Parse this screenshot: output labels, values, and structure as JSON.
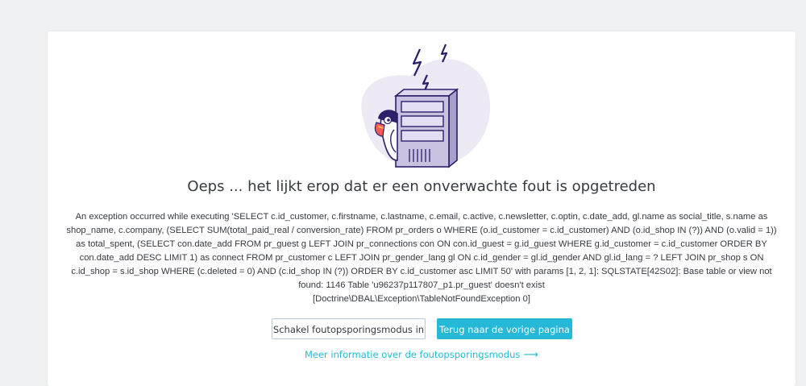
{
  "error": {
    "title": "Oeps ... het lijkt erop dat er een onverwachte fout is opgetreden",
    "message": "An exception occurred while executing 'SELECT c.id_customer, c.firstname, c.lastname, c.email, c.active, c.newsletter, c.optin, c.date_add, gl.name as social_title, s.name as shop_name, c.company, (SELECT SUM(total_paid_real / conversion_rate) FROM pr_orders o WHERE (o.id_customer = c.id_customer) AND (o.id_shop IN (?)) AND (o.valid = 1)) as total_spent, (SELECT con.date_add FROM pr_guest g LEFT JOIN pr_connections con ON con.id_guest = g.id_guest WHERE g.id_customer = c.id_customer ORDER BY con.date_add DESC LIMIT 1) as connect FROM pr_customer c LEFT JOIN pr_gender_lang gl ON c.id_gender = gl.id_gender AND gl.id_lang = ? LEFT JOIN pr_shop s ON c.id_shop = s.id_shop WHERE (c.deleted = 0) AND (c.id_shop IN (?)) ORDER BY c.id_customer asc LIMIT 50' with params [1, 2, 1]: SQLSTATE[42S02]: Base table or view not found: 1146 Table 'u96237p117807_p1.pr_guest' doesn't exist",
    "exception_class": "[Doctrine\\DBAL\\Exception\\TableNotFoundException 0]"
  },
  "actions": {
    "debug_button": "Schakel foutopsporingsmodus in",
    "back_button": "Terug naar de vorige pagina",
    "more_info_link": "Meer informatie over de foutopsporingsmodus",
    "more_info_arrow": "⟶"
  },
  "colors": {
    "accent": "#25b9d7",
    "text": "#363a41",
    "background": "#eff1f2",
    "illustration_blob": "#edeaf5",
    "server": "#c8c2e0",
    "server_outline": "#2e1f6b"
  },
  "icons": {
    "illustration": "server-with-puffin-illustration",
    "lightning": "lightning-bolt-icon"
  }
}
